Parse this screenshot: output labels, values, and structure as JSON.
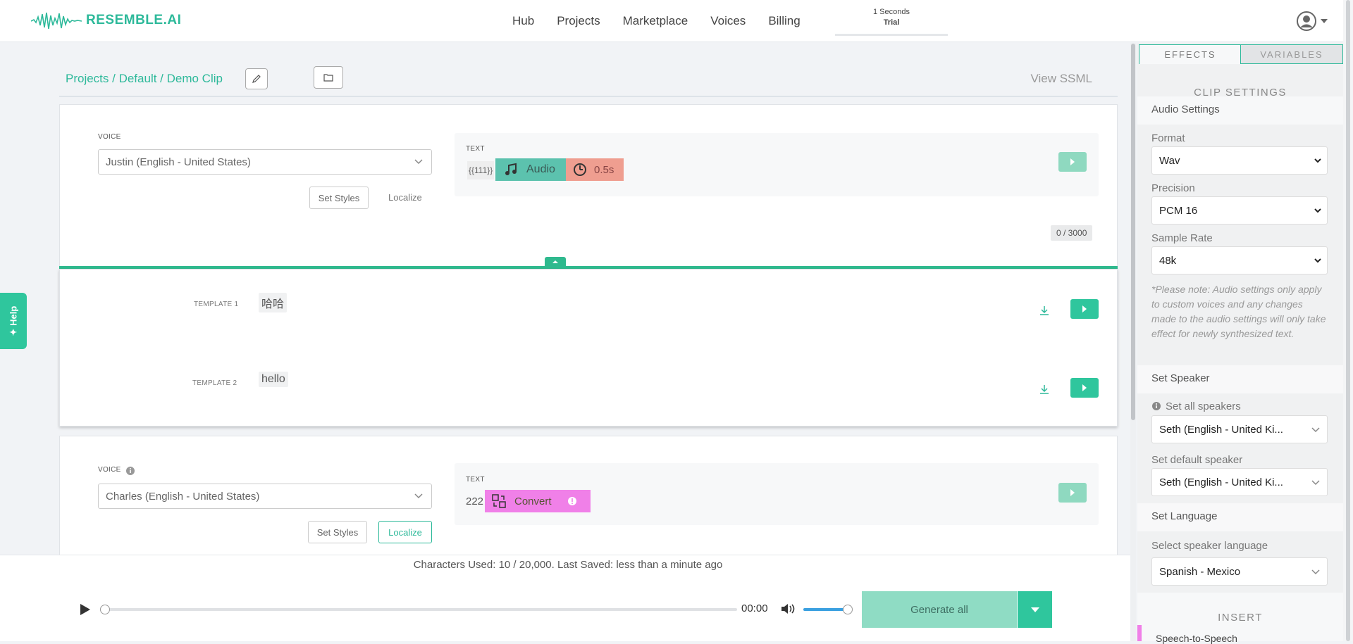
{
  "brand": {
    "name": "RESEMBLE.AI",
    "accent": "#2db99a"
  },
  "nav": {
    "items": [
      "Hub",
      "Projects",
      "Marketplace",
      "Voices",
      "Billing"
    ]
  },
  "trial": {
    "line1": "1 Seconds",
    "line2": "Trial"
  },
  "help": {
    "label": "Help"
  },
  "breadcrumb": "Projects / Default / Demo Clip",
  "view_ssml": "View SSML",
  "clip1": {
    "voice_label": "VOICE",
    "voice": "Justin (English - United States)",
    "set_styles": "Set Styles",
    "localize": "Localize",
    "text_label": "TEXT",
    "token": "{{111}}",
    "audio_tag": "Audio",
    "pause_tag": "0.5s",
    "counter": "0 / 3000"
  },
  "templates": [
    {
      "label": "TEMPLATE 1",
      "text": "哈哈"
    },
    {
      "label": "TEMPLATE 2",
      "text": "hello"
    }
  ],
  "clip2": {
    "voice_label": "VOICE",
    "voice": "Charles (English - United States)",
    "set_styles": "Set Styles",
    "localize": "Localize",
    "text_label": "TEXT",
    "text": "222",
    "convert_tag": "Convert"
  },
  "status": "Characters Used: 10 / 20,000. Last Saved: less than a minute ago",
  "player": {
    "time": "00:00",
    "generate": "Generate all",
    "progress": 0,
    "volume": 1.0
  },
  "panel": {
    "tabs": [
      "EFFECTS",
      "VARIABLES"
    ],
    "clip_settings": "CLIP SETTINGS",
    "audio_settings": "Audio Settings",
    "format_label": "Format",
    "format": "Wav",
    "precision_label": "Precision",
    "precision": "PCM 16",
    "rate_label": "Sample Rate",
    "rate": "48k",
    "note": "*Please note: Audio settings only apply to custom voices and any changes made to the audio settings will only take effect for newly synthesized text.",
    "set_speaker": "Set Speaker",
    "all_speakers_label": "Set all speakers",
    "all_speakers": "Seth (English - United Ki...",
    "default_speaker_label": "Set default speaker",
    "default_speaker": "Seth (English - United Ki...",
    "set_language": "Set Language",
    "lang_label": "Select speaker language",
    "lang": "Spanish - Mexico",
    "insert": "INSERT",
    "sts": "Speech-to-Speech"
  }
}
